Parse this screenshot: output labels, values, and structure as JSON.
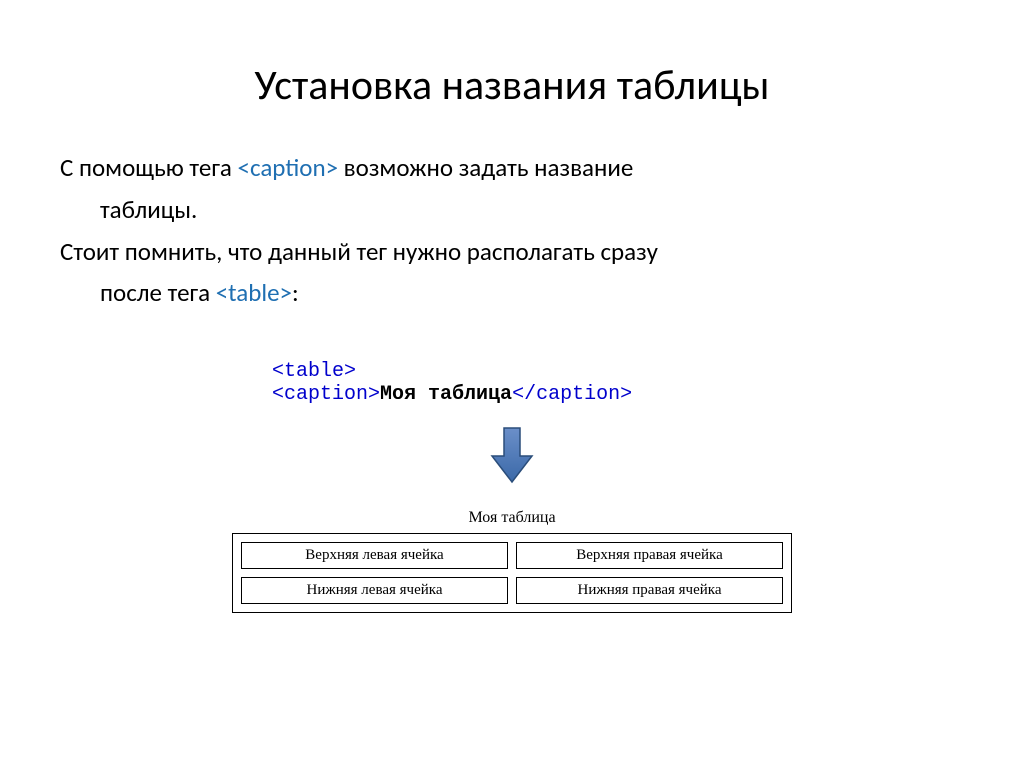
{
  "title": "Установка названия таблицы",
  "para1_a": "С помощью тега ",
  "para1_tag": "<caption>",
  "para1_b": "  возможно задать название",
  "para1_c": "таблицы.",
  "para2_a": "Стоит помнить, что данный тег нужно располагать сразу",
  "para2_b": "после тега ",
  "para2_tag": "<table>",
  "para2_c": ":",
  "code": {
    "table_open": "<table>",
    "caption_open": "<caption>",
    "caption_text": "Моя таблица",
    "caption_close": "</caption>"
  },
  "example": {
    "caption": "Моя таблица",
    "cells": {
      "tl": "Верхняя левая ячейка",
      "tr": "Верхняя правая ячейка",
      "bl": "Нижняя левая ячейка",
      "br": "Нижняя правая ячейка"
    }
  }
}
